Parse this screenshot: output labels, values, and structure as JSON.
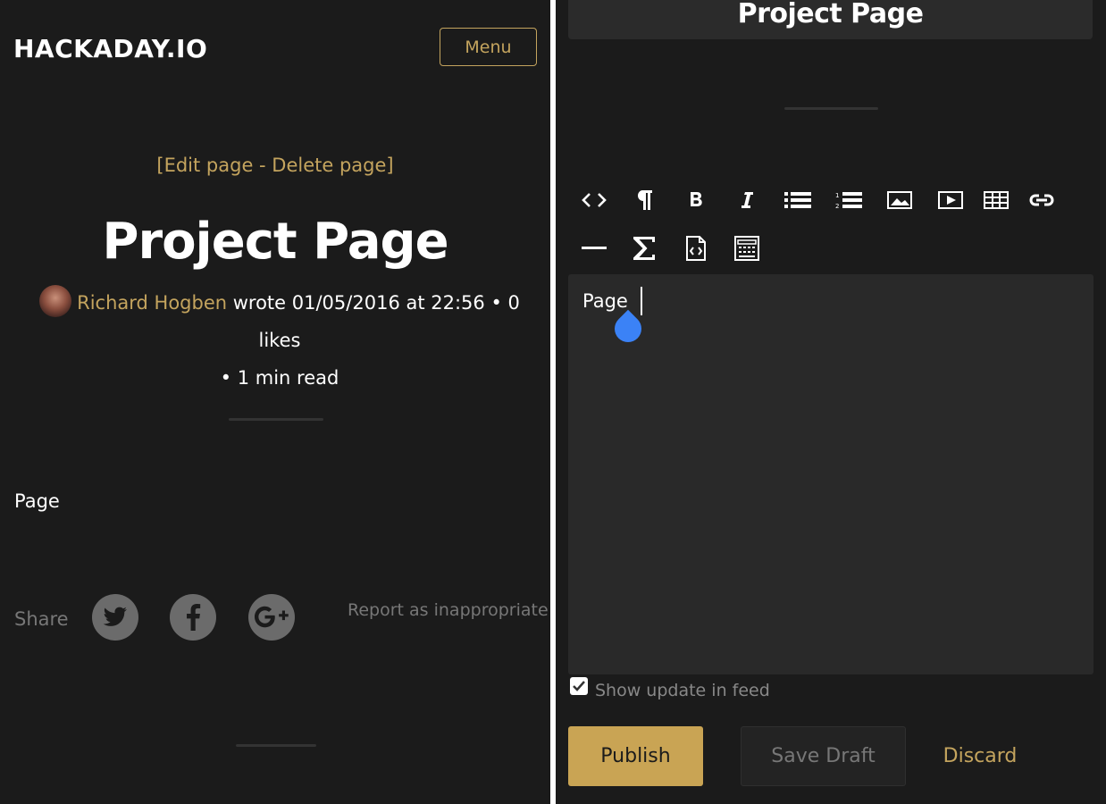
{
  "left": {
    "logo": "HACKADAY.IO",
    "menu_label": "Menu",
    "edit_link": "[Edit page",
    "edit_sep": " - ",
    "delete_link": "Delete page]",
    "title": "Project Page",
    "author": "Richard Hogben",
    "meta_line1_rest": " wrote 01/05/2016 at 22:56 • 0 likes",
    "meta_line2": "• 1 min read",
    "body": "Page",
    "share_label": "Share",
    "share_icons": [
      "twitter-icon",
      "facebook-icon",
      "google-plus-icon"
    ],
    "report_link": "Report as inappropriate"
  },
  "right": {
    "header_title": "Project Page",
    "toolbar_icons": [
      "code",
      "paragraph",
      "bold",
      "italic",
      "bulleted-list",
      "numbered-list",
      "image",
      "video",
      "table",
      "link",
      "horizontal-rule",
      "sigma",
      "code-file",
      "embed"
    ],
    "editor_text": "Page",
    "show_update_label": "Show update in feed",
    "show_update_checked": true,
    "publish_label": "Publish",
    "save_draft_label": "Save Draft",
    "discard_label": "Discard"
  },
  "colors": {
    "accent": "#c4a45e",
    "background": "#1b1b1b",
    "editor_bg": "#292929",
    "cursor_handle": "#3b82f6"
  }
}
